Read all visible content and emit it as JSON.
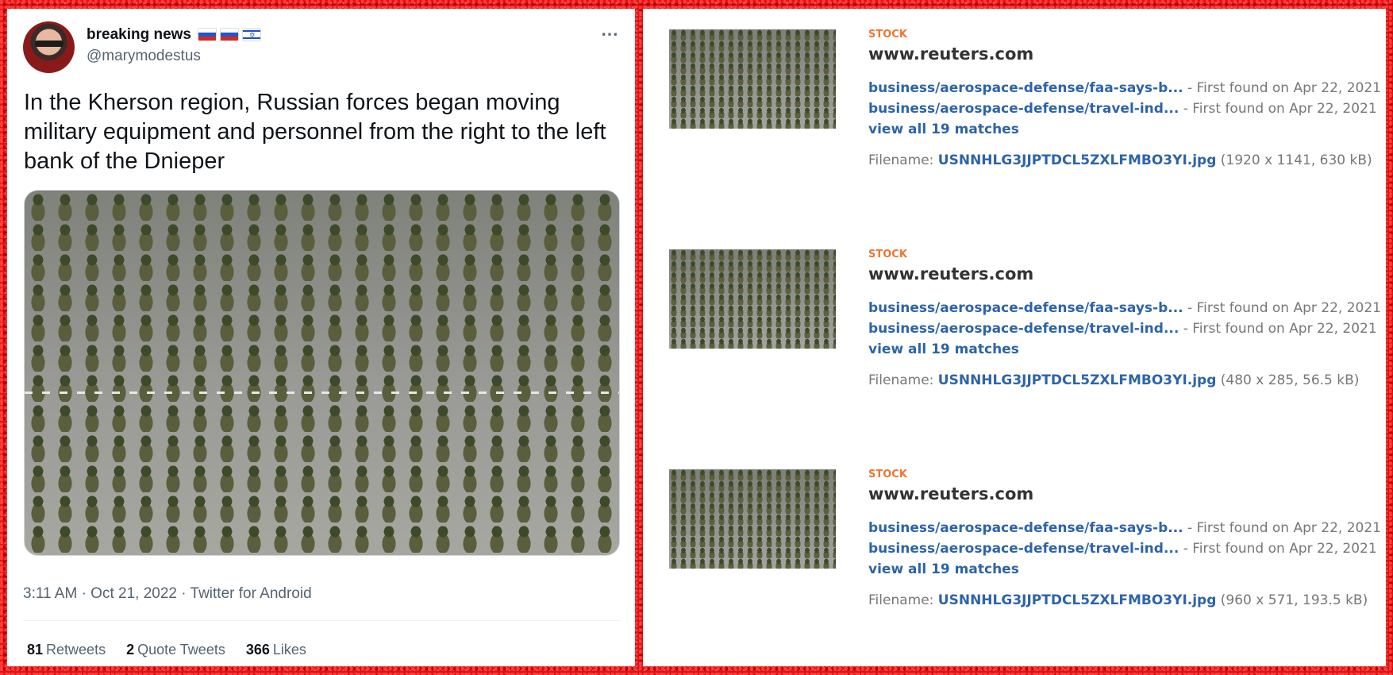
{
  "tweet": {
    "author_name": "breaking news",
    "flags": [
      "russia-flag",
      "russia-flag",
      "israel-flag"
    ],
    "handle": "@marymodestus",
    "more_icon": "⋯",
    "text": "In the Kherson region, Russian forces began moving military equipment and personnel from the right to the left bank of the Dnieper",
    "meta": "3:11 AM · Oct 21, 2022 · Twitter for Android",
    "stats": {
      "retweets_count": "81",
      "retweets_label": "Retweets",
      "quotes_count": "2",
      "quotes_label": "Quote Tweets",
      "likes_count": "366",
      "likes_label": "Likes"
    }
  },
  "results": [
    {
      "tag": "STOCK",
      "site": "www.reuters.com",
      "matches": [
        {
          "link": "business/aerospace-defense/faa-says-b...",
          "found": " - First found on Apr 22, 2021"
        },
        {
          "link": "business/aerospace-defense/travel-ind...",
          "found": " - First found on Apr 22, 2021"
        }
      ],
      "view_all": "view all 19 matches",
      "filename_label": "Filename: ",
      "filename": "USNNHLG3JJPTDCL5ZXLFMBO3YI.jpg",
      "filename_info": " (1920 x 1141, 630 kB)"
    },
    {
      "tag": "STOCK",
      "site": "www.reuters.com",
      "matches": [
        {
          "link": "business/aerospace-defense/faa-says-b...",
          "found": " - First found on Apr 22, 2021"
        },
        {
          "link": "business/aerospace-defense/travel-ind...",
          "found": " - First found on Apr 22, 2021"
        }
      ],
      "view_all": "view all 19 matches",
      "filename_label": "Filename: ",
      "filename": "USNNHLG3JJPTDCL5ZXLFMBO3YI.jpg",
      "filename_info": " (480 x 285, 56.5 kB)"
    },
    {
      "tag": "STOCK",
      "site": "www.reuters.com",
      "matches": [
        {
          "link": "business/aerospace-defense/faa-says-b...",
          "found": " - First found on Apr 22, 2021"
        },
        {
          "link": "business/aerospace-defense/travel-ind...",
          "found": " - First found on Apr 22, 2021"
        }
      ],
      "view_all": "view all 19 matches",
      "filename_label": "Filename: ",
      "filename": "USNNHLG3JJPTDCL5ZXLFMBO3YI.jpg",
      "filename_info": " (960 x 571, 193.5 kB)"
    }
  ],
  "colors": {
    "background": "#e01414",
    "link": "#2d64a8",
    "tag": "#f07530"
  }
}
